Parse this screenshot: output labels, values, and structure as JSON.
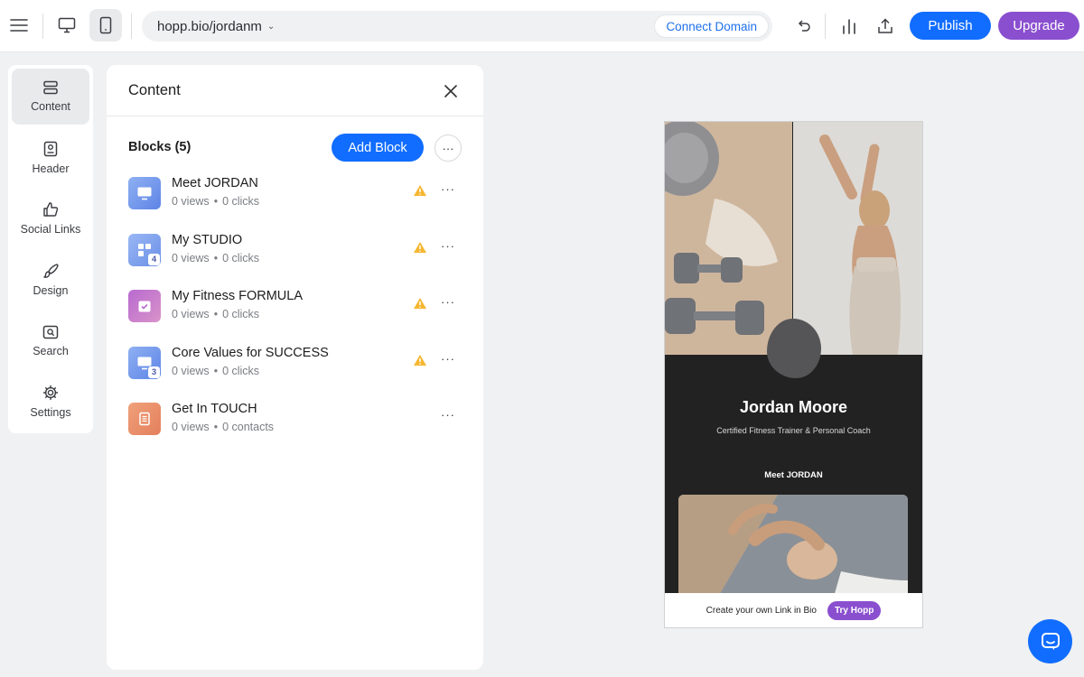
{
  "topbar": {
    "url": "hopp.bio/jordanm",
    "connect_domain": "Connect Domain",
    "publish": "Publish",
    "upgrade": "Upgrade"
  },
  "rail": {
    "items": [
      {
        "label": "Content",
        "icon": "layers-icon",
        "active": true
      },
      {
        "label": "Header",
        "icon": "header-icon"
      },
      {
        "label": "Social Links",
        "icon": "thumbs-up-icon"
      },
      {
        "label": "Design",
        "icon": "brush-icon"
      },
      {
        "label": "Search",
        "icon": "search-icon"
      },
      {
        "label": "Settings",
        "icon": "gear-icon"
      }
    ]
  },
  "panel": {
    "title": "Content",
    "blocks_label": "Blocks (5)",
    "add_block": "Add Block",
    "blocks": [
      {
        "name": "Meet JORDAN",
        "stat1": "0 views",
        "stat2": "0 clicks",
        "warning": true,
        "badge": ""
      },
      {
        "name": "My STUDIO",
        "stat1": "0 views",
        "stat2": "0 clicks",
        "warning": true,
        "badge": "4"
      },
      {
        "name": "My Fitness FORMULA",
        "stat1": "0 views",
        "stat2": "0 clicks",
        "warning": true,
        "badge": ""
      },
      {
        "name": "Core Values for SUCCESS",
        "stat1": "0 views",
        "stat2": "0 clicks",
        "warning": true,
        "badge": "3"
      },
      {
        "name": "Get In TOUCH",
        "stat1": "0 views",
        "stat2": "0 contacts",
        "warning": false,
        "badge": ""
      }
    ],
    "stat_separator": "•"
  },
  "preview": {
    "name": "Jordan Moore",
    "subtitle": "Certified Fitness Trainer & Personal Coach",
    "first_block": "Meet JORDAN",
    "promo_text": "Create your own Link in Bio",
    "promo_button": "Try Hopp"
  },
  "colors": {
    "accent": "#116dff",
    "upgrade": "#8a4fcf",
    "warning": "#f5b731"
  }
}
